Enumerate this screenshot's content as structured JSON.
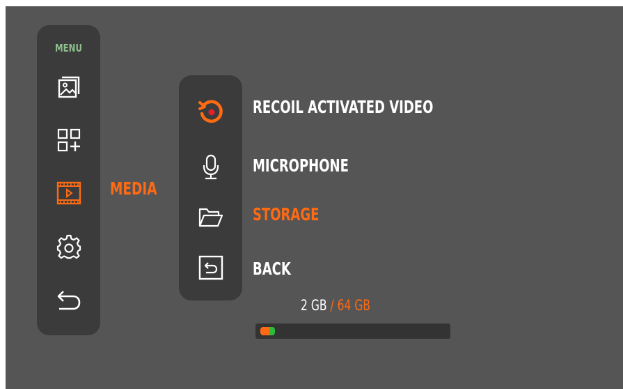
{
  "colors": {
    "accent": "#ff6a13",
    "menu_title": "#8fbf8a",
    "panel": "#3b3b3b",
    "background": "#555555",
    "text": "#ffffff",
    "green": "#2dbb3b"
  },
  "sidebar": {
    "title": "MENU",
    "items": [
      {
        "icon": "gallery-icon"
      },
      {
        "icon": "apps-add-icon"
      },
      {
        "icon": "media-icon",
        "label": "MEDIA",
        "active": true
      },
      {
        "icon": "settings-gear-icon"
      },
      {
        "icon": "back-arrow-icon"
      }
    ]
  },
  "submenu": {
    "items": [
      {
        "icon": "recoil-record-icon",
        "label": "RECOIL ACTIVATED VIDEO"
      },
      {
        "icon": "microphone-icon",
        "label": "MICROPHONE"
      },
      {
        "icon": "folder-icon",
        "label": "STORAGE",
        "active": true
      },
      {
        "icon": "back-box-icon",
        "label": "BACK"
      }
    ]
  },
  "storage": {
    "used": "2 GB",
    "total": "/ 64 GB",
    "used_fraction": 0.031
  }
}
